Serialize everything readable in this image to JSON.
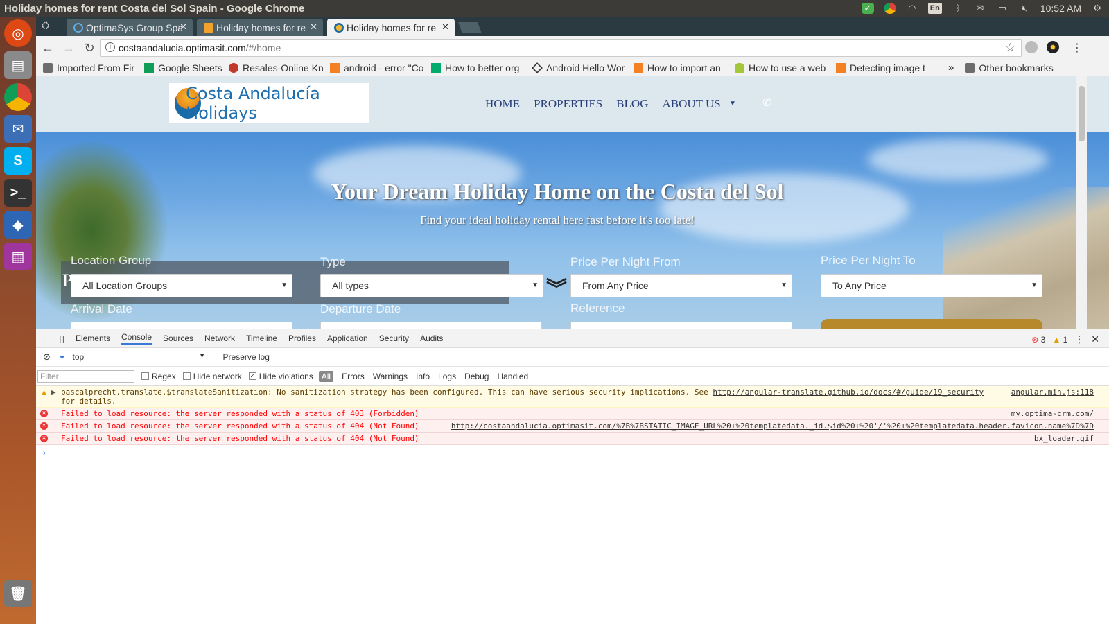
{
  "window_title": "Holiday homes for rent Costa del Sol Spain - Google Chrome",
  "tray": {
    "lang": "En",
    "time": "10:52 AM"
  },
  "tabs": [
    {
      "label": "OptimaSys Group Spa"
    },
    {
      "label": "Holiday homes for re"
    },
    {
      "label": "Holiday homes for re"
    }
  ],
  "address": {
    "host": "costaandalucia.optimasit.com",
    "path": "/#/home"
  },
  "bookmarks": [
    {
      "label": "Imported From Fir"
    },
    {
      "label": "Google Sheets"
    },
    {
      "label": "Resales-Online Kn"
    },
    {
      "label": "android - error \"Co"
    },
    {
      "label": "How to better org"
    },
    {
      "label": "Android Hello Wor"
    },
    {
      "label": "How to import an"
    },
    {
      "label": "How to use a web"
    },
    {
      "label": "Detecting image t"
    }
  ],
  "bookmarks_more": "»",
  "other_bookmarks": "Other bookmarks",
  "site": {
    "brand": "Costa Andalucía Holidays",
    "nav": [
      "HOME",
      "PROPERTIES",
      "BLOG",
      "ABOUT US"
    ],
    "hero_title": "Your Dream Holiday Home on the Costa del Sol",
    "hero_sub": "Find your ideal holiday rental here fast before it's too late!",
    "banner_text": "P                                          AMIS",
    "search": {
      "location_label": "Location Group",
      "location_value": "All Location Groups",
      "type_label": "Type",
      "type_value": "All types",
      "price_from_label": "Price Per Night From",
      "price_from_value": "From Any Price",
      "price_to_label": "Price Per Night To",
      "price_to_value": "To Any Price",
      "arrival_label": "Arrival Date",
      "departure_label": "Departure Date",
      "reference_label": "Reference"
    }
  },
  "devtools": {
    "tabs": [
      "Elements",
      "Console",
      "Sources",
      "Network",
      "Timeline",
      "Profiles",
      "Application",
      "Security",
      "Audits"
    ],
    "active_tab": "Console",
    "error_count": "3",
    "warning_count": "1",
    "context": "top",
    "preserve_log": "Preserve log",
    "filter_placeholder": "Filter",
    "regex": "Regex",
    "hide_network": "Hide network",
    "hide_violations": "Hide violations",
    "levels": [
      "All",
      "Errors",
      "Warnings",
      "Info",
      "Logs",
      "Debug",
      "Handled"
    ],
    "messages": [
      {
        "type": "warn",
        "text": "pascalprecht.translate.$translateSanitization: No sanitization strategy has been configured. This can have serious security implications. See",
        "link": "http://angular-translate.github.io/docs/#/guide/19_security",
        "tail": "for details.",
        "source": "angular.min.js:118"
      },
      {
        "type": "err",
        "text": "Failed to load resource: the server responded with a status of 403 (Forbidden)",
        "source": "my.optima-crm.com/"
      },
      {
        "type": "err",
        "text": "Failed to load resource: the server responded with a status of 404 (Not Found)",
        "source": "http://costaandalucia.optimasit.com/%7B%7BSTATIC_IMAGE_URL%20+%20templatedata._id.$id%20+%20'/'%20+%20templatedata.header.favicon.name%7D%7D"
      },
      {
        "type": "err",
        "text": "Failed to load resource: the server responded with a status of 404 (Not Found)",
        "source": "bx_loader.gif"
      }
    ]
  },
  "colors": {
    "accent": "#3879d9",
    "error": "#ff0000",
    "warning": "#5c3c00",
    "site_nav": "#2a3f7a",
    "header_bg": "#dce7ee"
  }
}
